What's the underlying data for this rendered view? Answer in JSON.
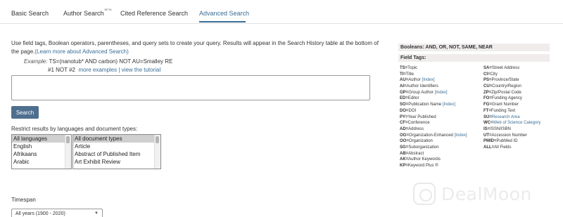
{
  "tabs": [
    {
      "label": "Basic Search"
    },
    {
      "label": "Author Search",
      "badge": "BETA"
    },
    {
      "label": "Cited Reference Search"
    },
    {
      "label": "Advanced Search",
      "active": true
    }
  ],
  "intro": {
    "text": "Use field tags, Boolean operators, parentheses, and query sets to create your query. Results will appear in the Search History table at the bottom of the page.",
    "link": "(Learn more about Advanced Search)"
  },
  "example": {
    "label": "Example:",
    "query": "TS=(nanotub* AND carbon) NOT AU=Smalley RE",
    "query2": "#1 NOT #2",
    "more_link": "more examples",
    "separator": "|",
    "tutorial_link": "view the tutorial"
  },
  "query_box": {
    "value": "",
    "placeholder": ""
  },
  "search_button": "Search",
  "restrict_label": "Restrict results by languages and document types:",
  "languages": [
    "All languages",
    "English",
    "Afrikaans",
    "Arabic"
  ],
  "document_types": [
    "All document types",
    "Article",
    "Abstract of Published Item",
    "Art Exhibit Review"
  ],
  "timespan": {
    "label": "Timespan",
    "value": "All years (1900 - 2020)"
  },
  "booleans": "Booleans: AND, OR, NOT, SAME, NEAR",
  "field_tags_title": "Field Tags:",
  "field_tags_left": [
    {
      "tag": "TS=",
      "name": "Topic",
      "extra": ""
    },
    {
      "tag": "TI=",
      "name": "Title",
      "extra": ""
    },
    {
      "tag": "AU=",
      "name": "Author",
      "extra": "[Index]"
    },
    {
      "tag": "AI=",
      "name": "Author Identifiers",
      "extra": ""
    },
    {
      "tag": "GP=",
      "name": "Group Author",
      "extra": "[Index]"
    },
    {
      "tag": "ED=",
      "name": "Editor",
      "extra": ""
    },
    {
      "tag": "SO=",
      "name": "Publication Name",
      "extra": "[Index]"
    },
    {
      "tag": "DO=",
      "name": "DOI",
      "extra": ""
    },
    {
      "tag": "PY=",
      "name": "Year Published",
      "extra": ""
    },
    {
      "tag": "CF=",
      "name": "Conference",
      "extra": ""
    },
    {
      "tag": "AD=",
      "name": "Address",
      "extra": ""
    },
    {
      "tag": "OG=",
      "name": "Organization-Enhanced",
      "extra": "[Index]"
    },
    {
      "tag": "OO=",
      "name": "Organization",
      "extra": ""
    },
    {
      "tag": "SG=",
      "name": "Suborganization",
      "extra": ""
    },
    {
      "tag": "AB=",
      "name": "Abstract",
      "extra": ""
    },
    {
      "tag": "AK=",
      "name": "Author Keywords",
      "extra": ""
    },
    {
      "tag": "KP=",
      "name": "Keyword Plus",
      "extra": "®"
    }
  ],
  "field_tags_right": [
    {
      "tag": "SA=",
      "name": "Street Address",
      "link": false
    },
    {
      "tag": "CI=",
      "name": "City",
      "link": false
    },
    {
      "tag": "PS=",
      "name": "Province/State",
      "link": false
    },
    {
      "tag": "CU=",
      "name": "Country/Region",
      "link": false
    },
    {
      "tag": "ZP=",
      "name": "Zip/Postal Code",
      "link": false
    },
    {
      "tag": "FO=",
      "name": "Funding Agency",
      "link": false
    },
    {
      "tag": "FG=",
      "name": "Grant Number",
      "link": false
    },
    {
      "tag": "FT=",
      "name": "Funding Text",
      "link": false
    },
    {
      "tag": "SU=",
      "name": "Research Area",
      "link": true
    },
    {
      "tag": "WC=",
      "name": "Web of Science Category",
      "link": true
    },
    {
      "tag": "IS=",
      "name": "ISSN/ISBN",
      "link": false
    },
    {
      "tag": "UT=",
      "name": "Accession Number",
      "link": false
    },
    {
      "tag": "PMID=",
      "name": "PubMed ID",
      "link": false
    },
    {
      "tag": "ALL=",
      "name": "All Fields",
      "link": false
    }
  ],
  "watermark": "DealMoon",
  "colors": {
    "accent": "#3a6d95",
    "button": "#4f6f8f",
    "panel_header": "#f0ecec"
  },
  "icons": {
    "dropdown": "chevron-down-icon",
    "watermark_logo": "dealmoon-logo-icon"
  }
}
